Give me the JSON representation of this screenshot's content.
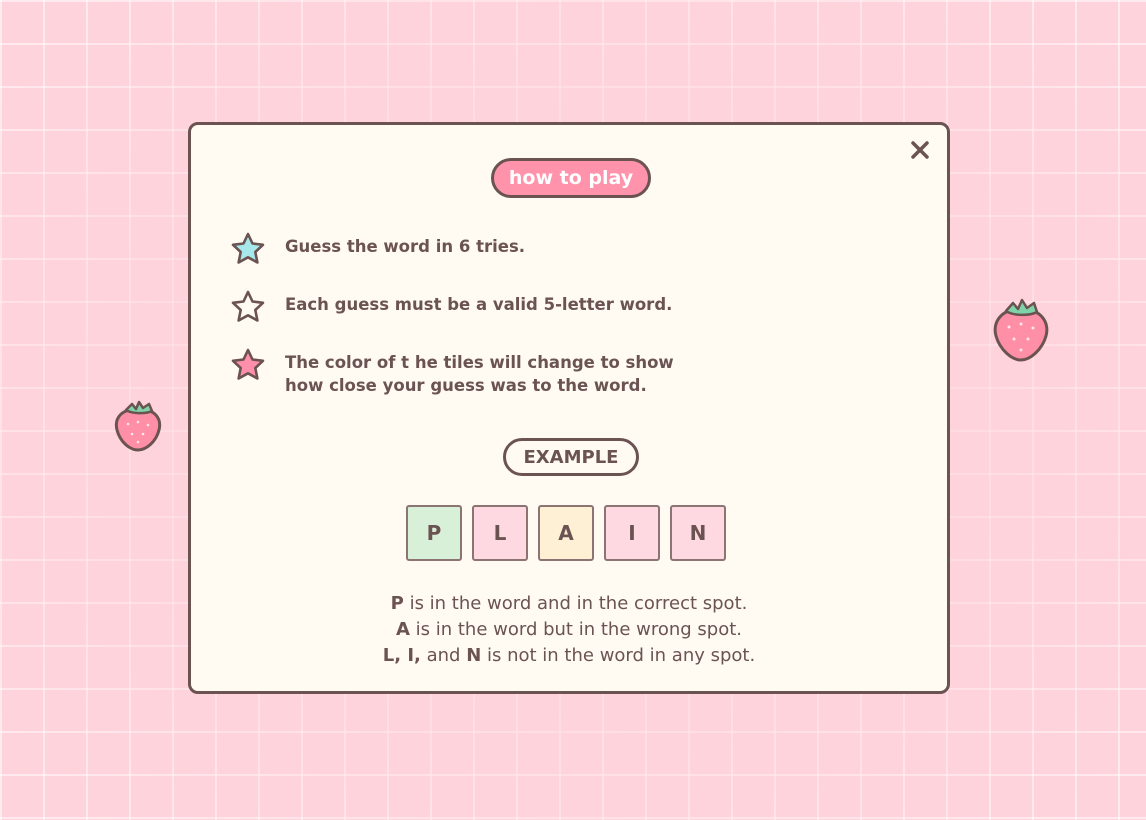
{
  "modal": {
    "title": "how to play",
    "close_icon": "close-icon",
    "rules": [
      {
        "icon": "star-blue-icon",
        "text": "Guess the word in 6 tries."
      },
      {
        "icon": "star-outline-icon",
        "text": "Each guess must be a valid 5-letter word."
      },
      {
        "icon": "star-pink-icon",
        "text": "The color of t he tiles will change to show\nhow close your guess was to the word."
      }
    ],
    "example_label": "EXAMPLE",
    "tiles": [
      {
        "letter": "P",
        "state": "correct"
      },
      {
        "letter": "L",
        "state": "absent"
      },
      {
        "letter": "A",
        "state": "present"
      },
      {
        "letter": "I",
        "state": "absent"
      },
      {
        "letter": "N",
        "state": "absent"
      }
    ],
    "legend": {
      "line1_bold": "P",
      "line1_rest": " is in the word and in the correct spot.",
      "line2_bold": "A",
      "line2_rest": " is in the word but in the wrong spot.",
      "line3_bold": "L, I,",
      "line3_mid": " and ",
      "line3_bold2": "N",
      "line3_rest": " is not in the word in any spot."
    }
  },
  "colors": {
    "background": "#ffd3dc",
    "accent_pink": "#ff93ab",
    "outline": "#6b5352",
    "tile_correct": "#d8f0d8",
    "tile_present": "#fdf0d5",
    "tile_absent": "#ffd9e2",
    "star_blue": "#a6e8ec",
    "star_pink": "#ff8fab"
  }
}
